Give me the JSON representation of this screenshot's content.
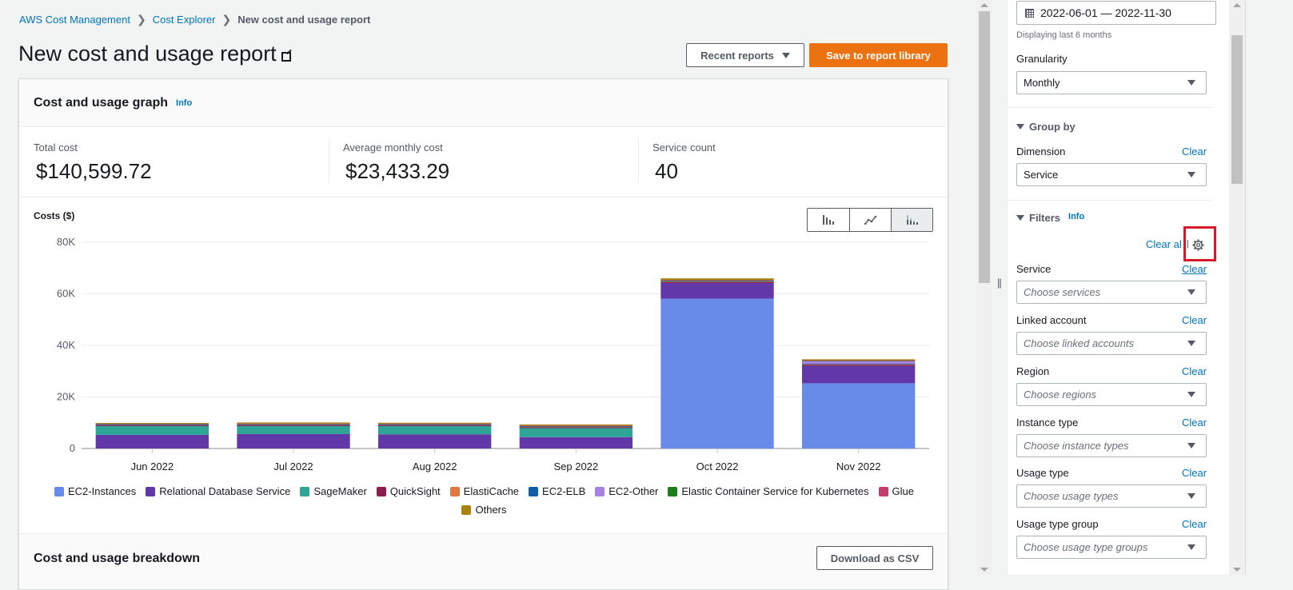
{
  "breadcrumb": {
    "items": [
      "AWS Cost Management",
      "Cost Explorer"
    ],
    "current": "New cost and usage report"
  },
  "header": {
    "title": "New cost and usage report",
    "recent_reports_label": "Recent reports",
    "save_label": "Save to report library"
  },
  "graph_panel": {
    "title": "Cost and usage graph",
    "info_label": "Info",
    "metrics": [
      {
        "label": "Total cost",
        "value": "$140,599.72"
      },
      {
        "label": "Average monthly cost",
        "value": "$23,433.29"
      },
      {
        "label": "Service count",
        "value": "40"
      }
    ],
    "costs_label": "Costs ($)",
    "chart_type_buttons": [
      {
        "icon": "bar-chart-icon",
        "active": false
      },
      {
        "icon": "line-chart-icon",
        "active": false
      },
      {
        "icon": "stacked-bar-chart-icon",
        "active": true
      }
    ]
  },
  "breakdown": {
    "title": "Cost and usage breakdown",
    "download_label": "Download as CSV"
  },
  "chart_data": {
    "type": "bar",
    "stacked": true,
    "title": "Cost and usage graph",
    "ylabel": "Costs ($)",
    "xlabel": "",
    "ylim": [
      0,
      80000
    ],
    "yticks": [
      0,
      20000,
      40000,
      60000,
      80000
    ],
    "ytick_labels": [
      "0",
      "20K",
      "40K",
      "60K",
      "80K"
    ],
    "grid": true,
    "legend_position": "bottom",
    "categories": [
      "Jun 2022",
      "Jul 2022",
      "Aug 2022",
      "Sep 2022",
      "Oct 2022",
      "Nov 2022"
    ],
    "series": [
      {
        "name": "EC2-Instances",
        "color": "#688ae8",
        "values": [
          0,
          0,
          0,
          0,
          58100,
          25300
        ]
      },
      {
        "name": "Relational Database Service",
        "color": "#6237a8",
        "values": [
          5300,
          5600,
          5500,
          4400,
          6100,
          6800
        ]
      },
      {
        "name": "SageMaker",
        "color": "#2ea597",
        "values": [
          3400,
          3100,
          3200,
          3500,
          0,
          0
        ]
      },
      {
        "name": "QuickSight",
        "color": "#8c1c4b",
        "values": [
          400,
          300,
          300,
          300,
          300,
          300
        ]
      },
      {
        "name": "ElastiCache",
        "color": "#e07941",
        "values": [
          200,
          300,
          300,
          300,
          400,
          400
        ]
      },
      {
        "name": "EC2-ELB",
        "color": "#0f5fa8",
        "values": [
          50,
          50,
          50,
          50,
          50,
          50
        ]
      },
      {
        "name": "EC2-Other",
        "color": "#a783e1",
        "values": [
          200,
          200,
          200,
          200,
          200,
          1200
        ]
      },
      {
        "name": "Elastic Container Service for Kubernetes",
        "color": "#1b7d1c",
        "values": [
          50,
          50,
          50,
          50,
          50,
          50
        ]
      },
      {
        "name": "Glue",
        "color": "#c33d69",
        "values": [
          100,
          100,
          100,
          100,
          200,
          150
        ]
      },
      {
        "name": "Others",
        "color": "#a8840c",
        "values": [
          200,
          400,
          300,
          400,
          600,
          350
        ]
      }
    ]
  },
  "sidebar": {
    "date_range": "2022-06-01 — 2022-11-30",
    "date_hint": "Displaying last 6 months",
    "granularity": {
      "label": "Granularity",
      "value": "Monthly"
    },
    "group_by": {
      "title": "Group by",
      "dimension_label": "Dimension",
      "dimension_value": "Service",
      "clear_label": "Clear"
    },
    "filters": {
      "title": "Filters",
      "info_label": "Info",
      "clear_all_label": "Clear al",
      "items": [
        {
          "label": "Service",
          "placeholder": "Choose services",
          "clear_label": "Clear"
        },
        {
          "label": "Linked account",
          "placeholder": "Choose linked accounts",
          "clear_label": "Clear"
        },
        {
          "label": "Region",
          "placeholder": "Choose regions",
          "clear_label": "Clear"
        },
        {
          "label": "Instance type",
          "placeholder": "Choose instance types",
          "clear_label": "Clear"
        },
        {
          "label": "Usage type",
          "placeholder": "Choose usage types",
          "clear_label": "Clear"
        },
        {
          "label": "Usage type group",
          "placeholder": "Choose usage type groups",
          "clear_label": "Clear"
        }
      ]
    }
  }
}
